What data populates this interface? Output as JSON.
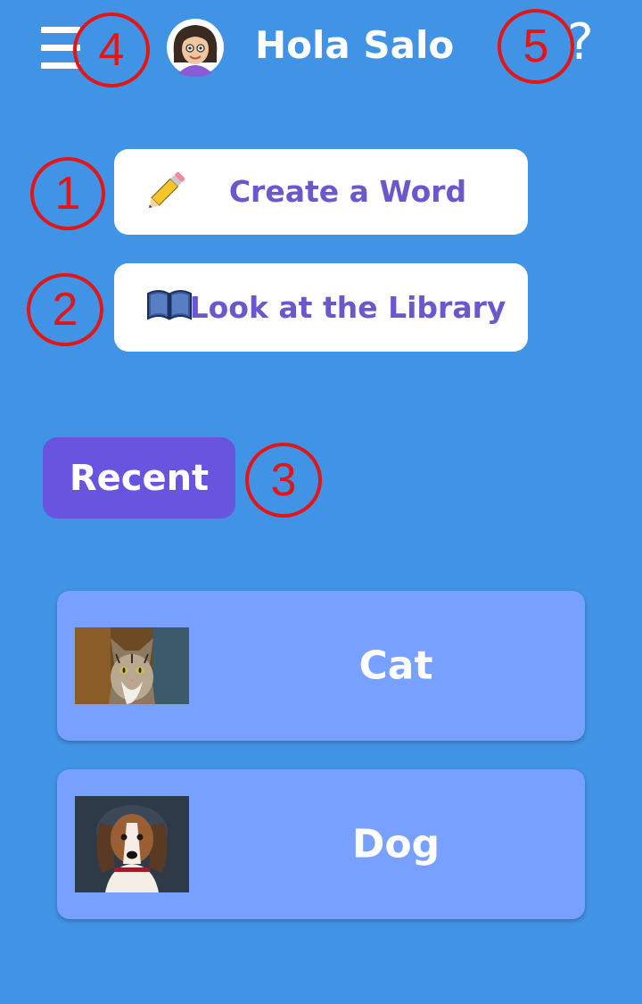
{
  "header": {
    "greeting": "Hola Salo",
    "menu_icon": "hamburger-menu-icon",
    "avatar_icon": "avatar-girl-icon",
    "help_icon": "question-mark-icon",
    "help_glyph": "?"
  },
  "actions": {
    "create_word": {
      "label": "Create a Word",
      "icon": "pencil-icon"
    },
    "library": {
      "label": "Look at the Library",
      "icon": "book-icon"
    }
  },
  "recent": {
    "tab_label": "Recent"
  },
  "words": [
    {
      "label": "Cat",
      "image": "cat-photo"
    },
    {
      "label": "Dog",
      "image": "dog-photo"
    }
  ],
  "annotations": [
    "1",
    "2",
    "3",
    "4",
    "5"
  ],
  "colors": {
    "background": "#4193e6",
    "button_bg": "#ffffff",
    "button_text": "#6a58cc",
    "recent_tab": "#6755e0",
    "card_bg": "#78a0ff",
    "annotation": "#e31515"
  }
}
